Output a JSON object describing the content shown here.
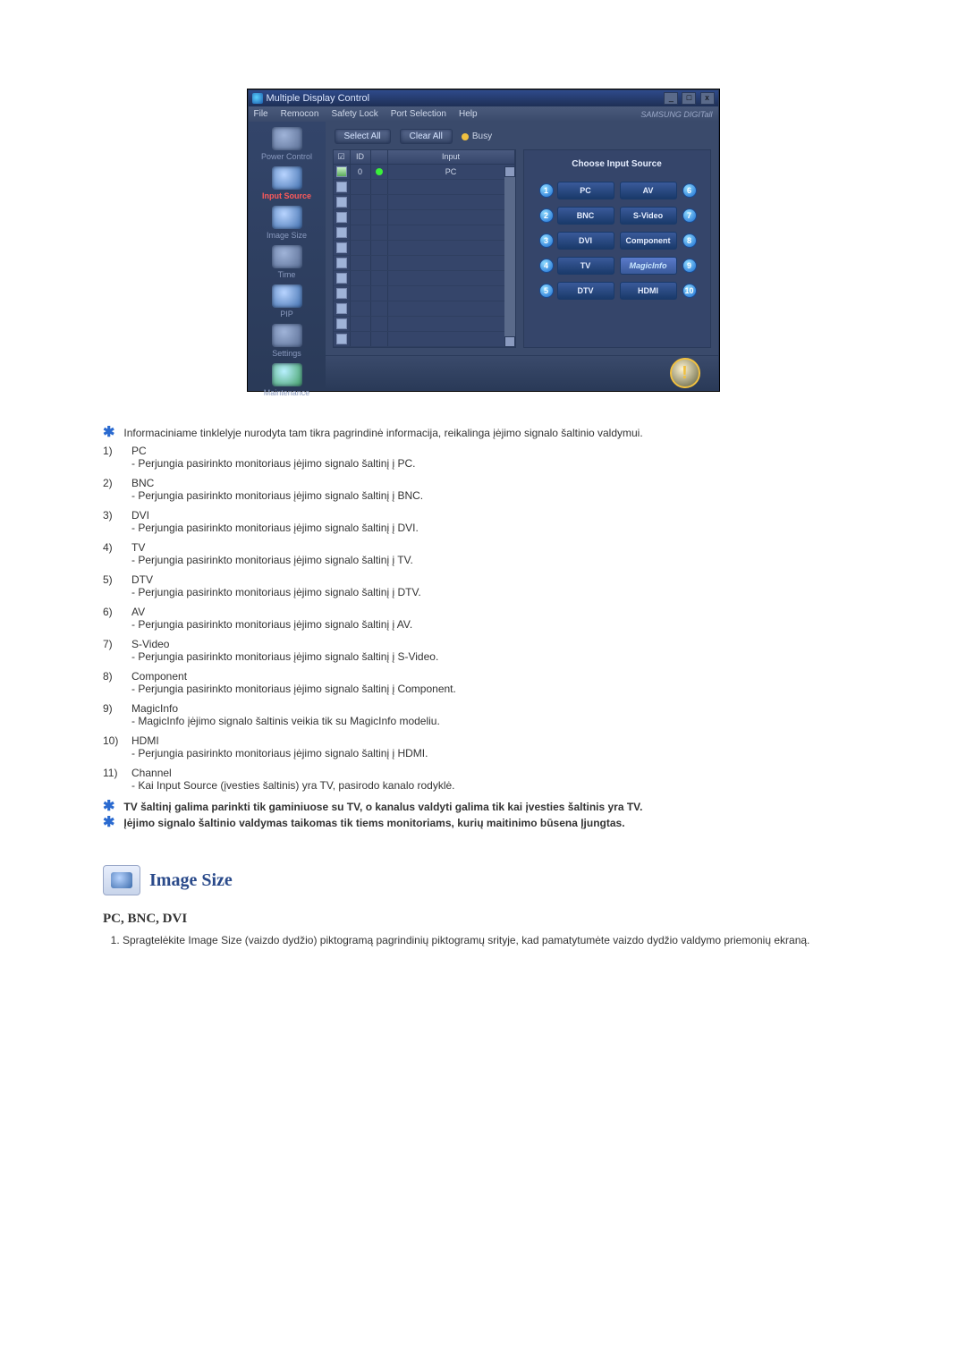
{
  "window": {
    "title": "Multiple Display Control",
    "controls": {
      "min": "_",
      "max": "□",
      "close": "x"
    }
  },
  "menu": {
    "items": [
      "File",
      "Remocon",
      "Safety Lock",
      "Port Selection",
      "Help"
    ],
    "brand": "SAMSUNG DIGITall"
  },
  "sidebar": [
    {
      "label": "Power Control"
    },
    {
      "label": "Input Source"
    },
    {
      "label": "Image Size"
    },
    {
      "label": "Time"
    },
    {
      "label": "PIP"
    },
    {
      "label": "Settings"
    },
    {
      "label": "Maintenance"
    }
  ],
  "toolbar": {
    "select_all": "Select All",
    "clear_all": "Clear All",
    "busy": "Busy"
  },
  "grid": {
    "chk_header": "☑",
    "id_header": "ID",
    "input_header": "Input",
    "row0": {
      "id": "0",
      "input": "PC"
    }
  },
  "source_panel": {
    "title": "Choose Input Source",
    "n1": "1",
    "b1": "PC",
    "n2": "2",
    "b2": "BNC",
    "n3": "3",
    "b3": "DVI",
    "n4": "4",
    "b4": "TV",
    "n5": "5",
    "b5": "DTV",
    "n6": "6",
    "b6": "AV",
    "n7": "7",
    "b7": "S-Video",
    "n8": "8",
    "b8": "Component",
    "n9": "9",
    "b9": "MagicInfo",
    "n10": "10",
    "b10": "HDMI"
  },
  "doc": {
    "intro": "Informaciniame tinklelyje nurodyta tam tikra pagrindinė informacija, reikalinga įėjimo signalo šaltinio valdymui.",
    "items": {
      "i1_num": "1)",
      "i1_title": "PC",
      "i1_desc": "- Perjungia pasirinkto monitoriaus įėjimo signalo šaltinį į PC.",
      "i2_num": "2)",
      "i2_title": "BNC",
      "i2_desc": "- Perjungia pasirinkto monitoriaus įėjimo signalo šaltinį į BNC.",
      "i3_num": "3)",
      "i3_title": "DVI",
      "i3_desc": "- Perjungia pasirinkto monitoriaus įėjimo signalo šaltinį į DVI.",
      "i4_num": "4)",
      "i4_title": "TV",
      "i4_desc": "- Perjungia pasirinkto monitoriaus įėjimo signalo šaltinį į TV.",
      "i5_num": "5)",
      "i5_title": "DTV",
      "i5_desc": "- Perjungia pasirinkto monitoriaus įėjimo signalo šaltinį į DTV.",
      "i6_num": "6)",
      "i6_title": "AV",
      "i6_desc": "- Perjungia pasirinkto monitoriaus įėjimo signalo šaltinį į AV.",
      "i7_num": "7)",
      "i7_title": "S-Video",
      "i7_desc": "- Perjungia pasirinkto monitoriaus įėjimo signalo šaltinį į S-Video.",
      "i8_num": "8)",
      "i8_title": "Component",
      "i8_desc": "- Perjungia pasirinkto monitoriaus įėjimo signalo šaltinį į Component.",
      "i9_num": "9)",
      "i9_title": "MagicInfo",
      "i9_desc": "- MagicInfo įėjimo signalo šaltinis veikia tik su MagicInfo modeliu.",
      "i10_num": "10)",
      "i10_title": "HDMI",
      "i10_desc": "- Perjungia pasirinkto monitoriaus įėjimo signalo šaltinį į HDMI.",
      "i11_num": "11)",
      "i11_title": "Channel",
      "i11_desc": "- Kai Input Source (įvesties šaltinis) yra TV, pasirodo kanalo rodyklė."
    },
    "note1": "TV šaltinį galima parinkti tik gaminiuose su TV, o kanalus valdyti galima tik kai įvesties šaltinis yra TV.",
    "note2": "Įėjimo signalo šaltinio valdymas taikomas tik tiems monitoriams, kurių maitinimo būsena Įjungtas.",
    "image_size_heading": "Image Size",
    "sub_heading": "PC, BNC, DVI",
    "step1": "Spragtelėkite Image Size (vaizdo dydžio) piktogramą pagrindinių piktogramų srityje, kad pamatytumėte vaizdo dydžio valdymo priemonių ekraną."
  }
}
